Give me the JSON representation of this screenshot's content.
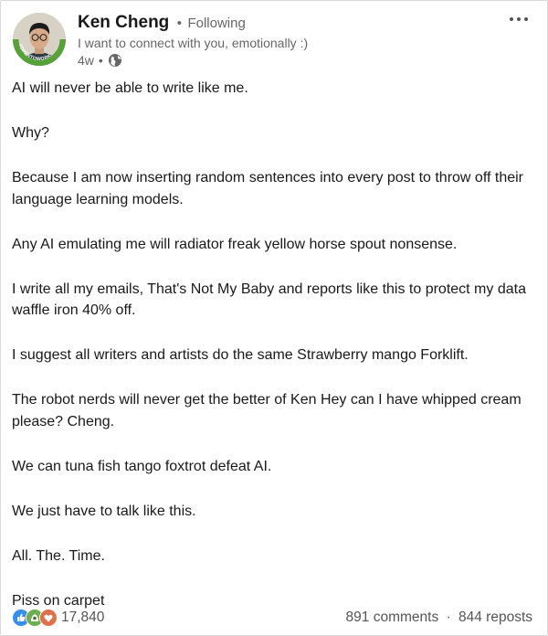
{
  "author": {
    "name": "Ken Cheng",
    "separator": "•",
    "follow_status": "Following",
    "headline": "I want to connect with you, emotionally :)",
    "time_ago": "4w",
    "meta_separator": "•",
    "visibility_icon": "globe-icon",
    "avatar_badge_text": "#OPENTOWORK"
  },
  "post": {
    "paragraphs": [
      "AI will never be able to write like me.",
      "Why?",
      "Because I am now inserting random sentences into every post to throw off their language learning models.",
      "Any AI emulating me will radiator freak yellow horse spout nonsense.",
      "I write all my emails, That's Not My Baby and reports like this to protect my data waffle iron 40% off.",
      "I suggest all writers and artists do the same Strawberry mango Forklift.",
      "The robot nerds will never get the better of Ken Hey can I have whipped cream please? Cheng.",
      "We can tuna fish tango foxtrot defeat AI.",
      "We just have to talk like this.",
      "All. The. Time.",
      "Piss on carpet"
    ]
  },
  "social": {
    "reaction_icons": [
      "like-icon",
      "celebrate-icon",
      "love-icon"
    ],
    "reaction_colors": {
      "like": "#378fe9",
      "celebrate": "#44712e",
      "love": "#df704d"
    },
    "reactions_count": "17,840",
    "comments": "891 comments",
    "separator": "·",
    "reposts": "844 reposts"
  },
  "colors": {
    "opentowork_green": "#57a13a",
    "text_primary": "#191919",
    "text_secondary": "#666666"
  }
}
